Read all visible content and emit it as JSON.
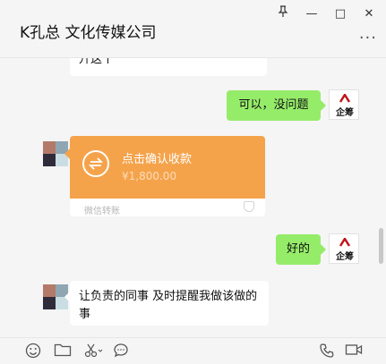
{
  "window": {
    "title": "K孔总 文化传媒公司",
    "controls": {
      "pin": "pin-icon",
      "minimize": "—",
      "maximize": "□",
      "close": "✕"
    },
    "more": "···"
  },
  "messages": {
    "top_partial": "升这个",
    "reply_ok": "可以，没问题",
    "transfer": {
      "title": "点击确认收款",
      "amount": "¥1,800.00",
      "footer": "微信转账"
    },
    "reply_good": "好的",
    "request": "让负责的同事 及时提醒我做该做的事"
  },
  "avatar": {
    "right_brand": "企筹"
  },
  "toolbar": {
    "icons": [
      "emoji-icon",
      "folder-icon",
      "scissors-icon",
      "chat-bubble-icon",
      "phone-icon",
      "video-icon"
    ]
  },
  "colors": {
    "bubble_self": "#95ec69",
    "transfer": "#f5a34b",
    "background": "#f5f5f5"
  }
}
